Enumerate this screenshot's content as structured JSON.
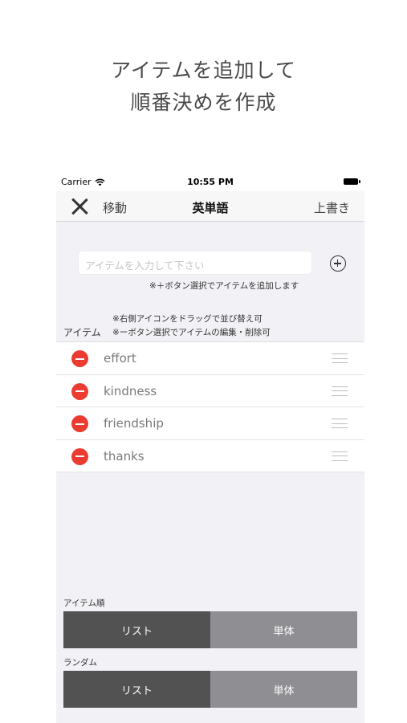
{
  "hero": {
    "line1": "アイテムを追加して",
    "line2": "順番決めを作成"
  },
  "status_bar": {
    "carrier": "Carrier",
    "time": "10:55 PM"
  },
  "nav": {
    "move_label": "移動",
    "title": "英単語",
    "overwrite_label": "上書き"
  },
  "add_section": {
    "placeholder": "アイテムを入力して下さい",
    "hint": "※＋ボタン選択でアイテムを追加します"
  },
  "items_section": {
    "header": "アイテム",
    "hint_drag": "※右側アイコンをドラッグで並び替え可",
    "hint_edit": "※ーボタン選択でアイテムの編集・削除可",
    "items": [
      {
        "label": "effort"
      },
      {
        "label": "kindness"
      },
      {
        "label": "friendship"
      },
      {
        "label": "thanks"
      }
    ]
  },
  "order_section": {
    "label": "アイテム順",
    "options": [
      "リスト",
      "単体"
    ],
    "selected": "リスト"
  },
  "random_section": {
    "label": "ランダム",
    "options": [
      "リスト",
      "単体"
    ],
    "selected": "リスト"
  },
  "colors": {
    "delete_red": "#ec3b30",
    "segment_selected": "#525252",
    "segment_unselected": "#8f8f93",
    "background": "#f2f2f6"
  }
}
